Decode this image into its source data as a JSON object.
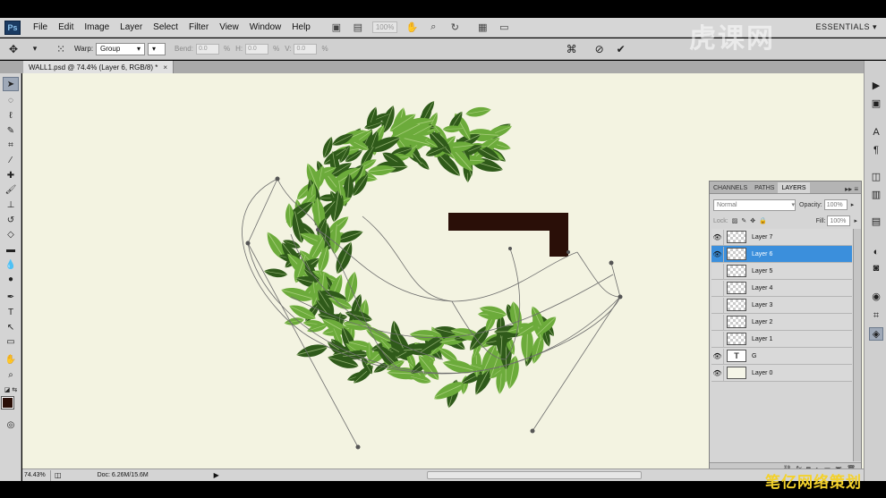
{
  "menubar": {
    "logo": "Ps",
    "items": [
      "File",
      "Edit",
      "Image",
      "Layer",
      "Select",
      "Filter",
      "View",
      "Window",
      "Help"
    ],
    "zoom": "100%",
    "workspace": "ESSENTIALS ▾"
  },
  "options": {
    "warp_label": "Warp:",
    "warp_value": "Group",
    "bend_label": "Bend:",
    "bend_value": "0.0",
    "h_label": "H:",
    "h_value": "0.0",
    "v_label": "V:",
    "v_value": "0.0",
    "pct": "%"
  },
  "document": {
    "tab_title": "WALL1.psd @ 74.4% (Layer 6, RGB/8) *",
    "close": "×"
  },
  "status": {
    "zoom": "74.43%",
    "doc_info": "Doc: 6.26M/15.6M"
  },
  "layers_panel": {
    "tabs": [
      "CHANNELS",
      "PATHS",
      "LAYERS"
    ],
    "active_tab": "LAYERS",
    "blend_mode": "Normal",
    "opacity_label": "Opacity:",
    "opacity": "100%",
    "lock_label": "Lock:",
    "fill_label": "Fill:",
    "fill": "100%",
    "layers": [
      {
        "name": "Layer 7",
        "visible": true,
        "selected": false,
        "kind": "pixel"
      },
      {
        "name": "Layer 6",
        "visible": true,
        "selected": true,
        "kind": "pixel"
      },
      {
        "name": "Layer 5",
        "visible": false,
        "selected": false,
        "kind": "pixel"
      },
      {
        "name": "Layer 4",
        "visible": false,
        "selected": false,
        "kind": "pixel"
      },
      {
        "name": "Layer 3",
        "visible": false,
        "selected": false,
        "kind": "pixel"
      },
      {
        "name": "Layer 2",
        "visible": false,
        "selected": false,
        "kind": "pixel"
      },
      {
        "name": "Layer 1",
        "visible": false,
        "selected": false,
        "kind": "pixel"
      },
      {
        "name": "G",
        "visible": true,
        "selected": false,
        "kind": "text"
      },
      {
        "name": "Layer 0",
        "visible": true,
        "selected": false,
        "kind": "solid"
      }
    ]
  },
  "watermark": {
    "top_right": "虎课网",
    "bottom_right": "笔亿网络策划"
  },
  "colors": {
    "canvas": "#f3f3e1",
    "selected_layer": "#3b8fdc",
    "g_letter": "#2a0f08",
    "leaf_dark": "#2f5a1a",
    "leaf_light": "#6cab3b"
  }
}
